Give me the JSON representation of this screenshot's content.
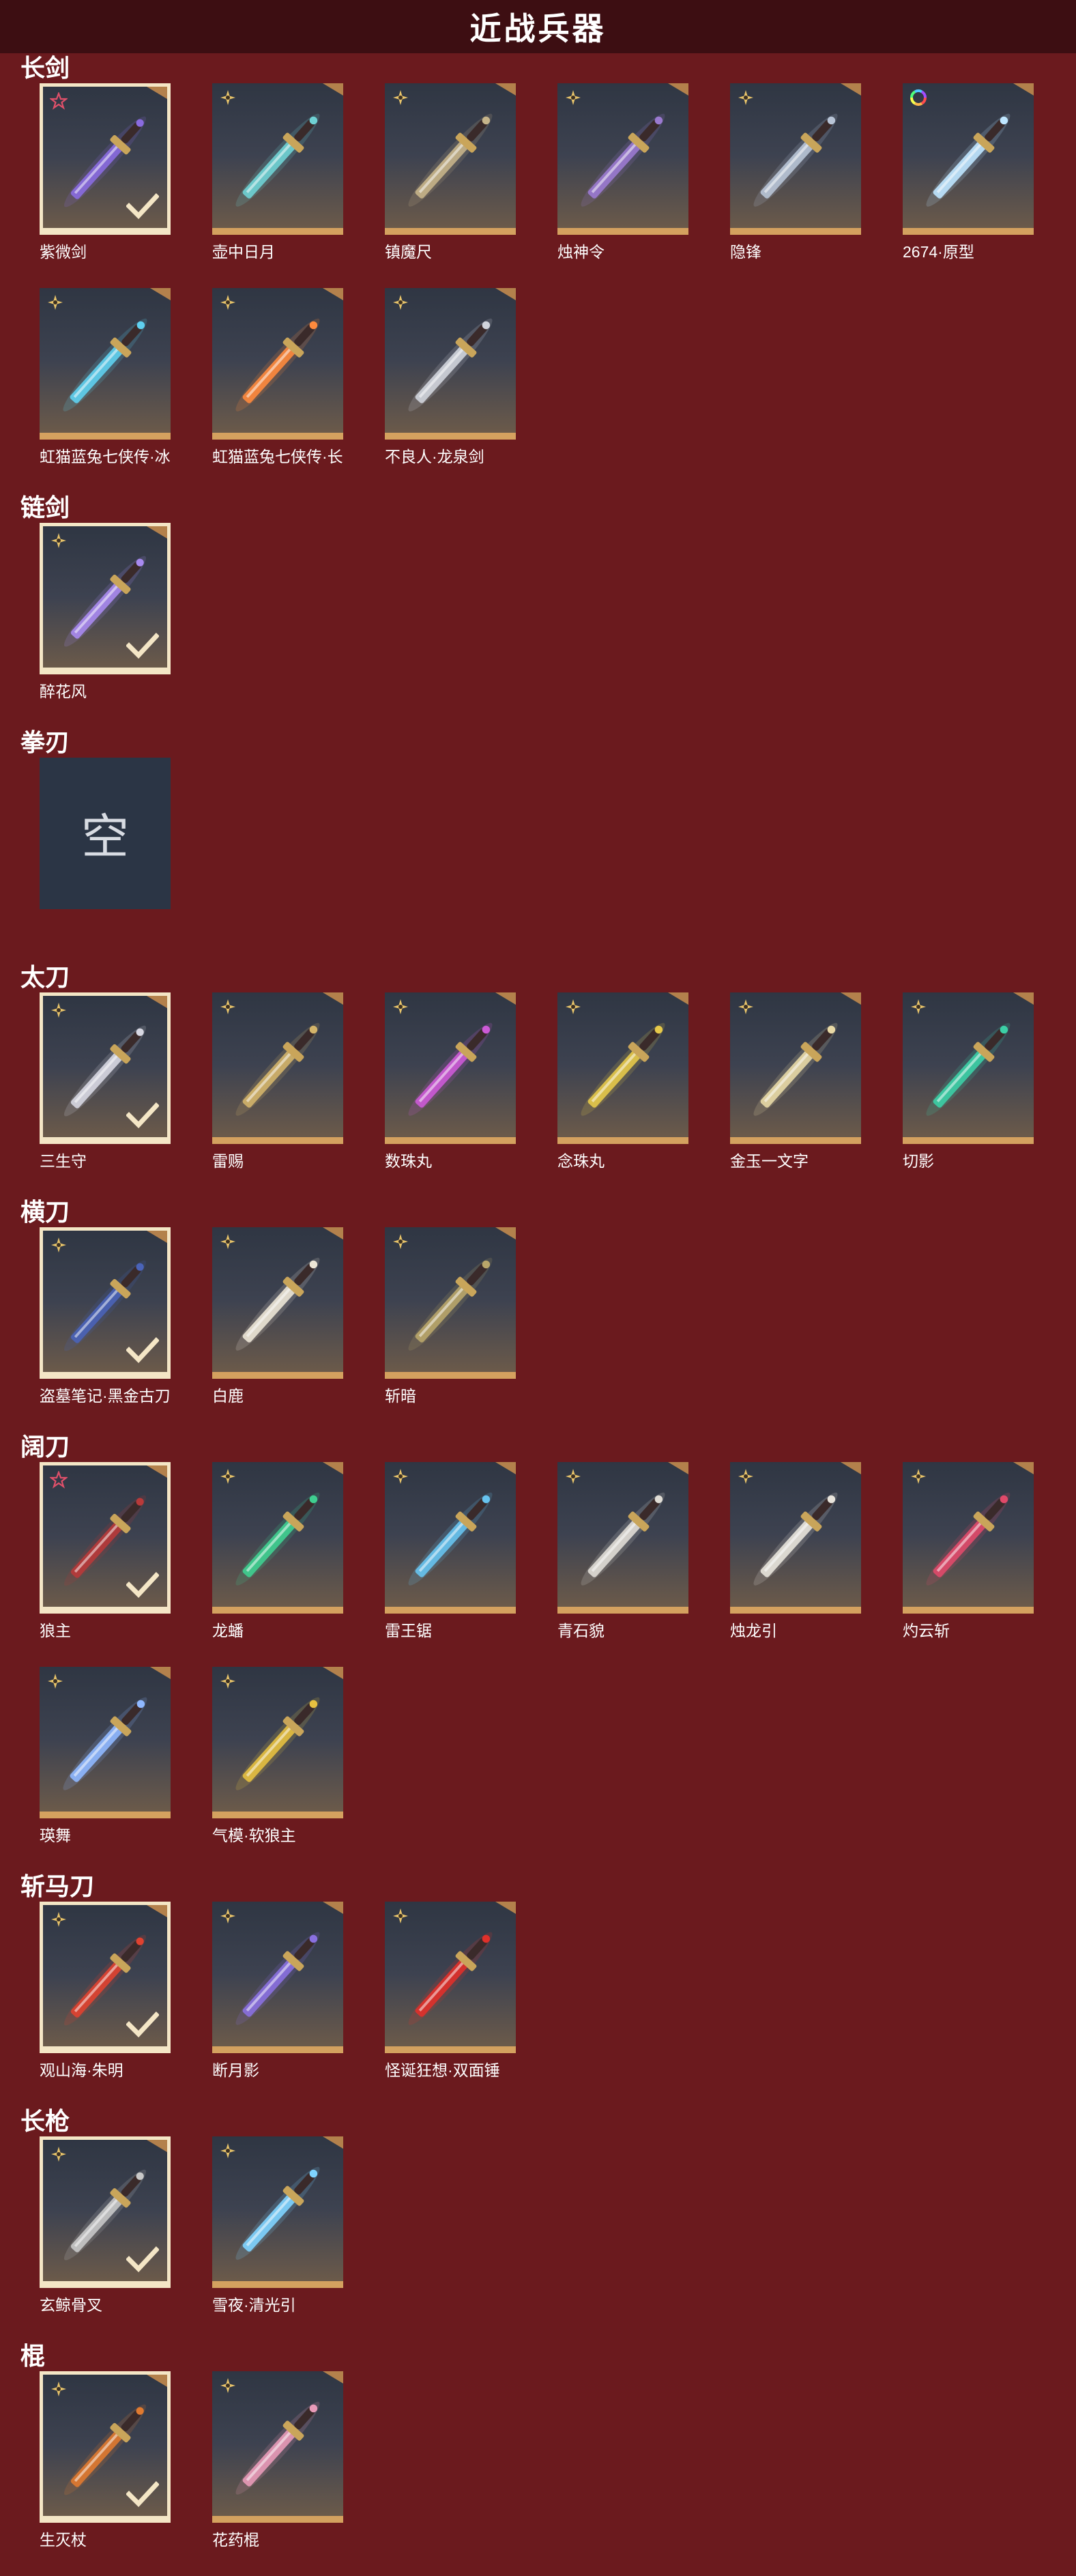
{
  "title": "近战兵器",
  "empty_char": "空",
  "categories": [
    {
      "name": "长剑",
      "rows": [
        [
          {
            "label": "紫微剑",
            "badge": "star",
            "sel": true,
            "c": "#8a6be0"
          },
          {
            "label": "壶中日月",
            "badge": "sparkle",
            "sel": false,
            "c": "#6fd1d4"
          },
          {
            "label": "镇魔尺",
            "badge": "sparkle",
            "sel": false,
            "c": "#c6b48a"
          },
          {
            "label": "烛神令",
            "badge": "sparkle",
            "sel": false,
            "c": "#9b7ad0"
          },
          {
            "label": "隐锋",
            "badge": "sparkle",
            "sel": false,
            "c": "#b8c4d6"
          },
          {
            "label": "2674·原型",
            "badge": "rainbow",
            "sel": false,
            "c": "#bfe6ff"
          }
        ],
        [
          {
            "label": "虹猫蓝兔七侠传·冰魄...",
            "badge": "sparkle",
            "sel": false,
            "c": "#5fd0ef"
          },
          {
            "label": "虹猫蓝兔七侠传·长虹...",
            "badge": "sparkle",
            "sel": false,
            "c": "#ff8a3d"
          },
          {
            "label": "不良人·龙泉剑",
            "badge": "sparkle",
            "sel": false,
            "c": "#d0d4dc"
          }
        ]
      ]
    },
    {
      "name": "链剑",
      "rows": [
        [
          {
            "label": "醉花风",
            "badge": "sparkle",
            "sel": true,
            "c": "#a88af0"
          }
        ]
      ]
    },
    {
      "name": "拳刃",
      "rows": [
        [
          {
            "label": "",
            "badge": "none",
            "sel": false,
            "empty": true
          }
        ]
      ]
    },
    {
      "name": "太刀",
      "rows": [
        [
          {
            "label": "三生守",
            "badge": "sparkle",
            "sel": true,
            "c": "#d7d7e2"
          },
          {
            "label": "雷赐",
            "badge": "sparkle",
            "sel": false,
            "c": "#d3b46a"
          },
          {
            "label": "数珠丸",
            "badge": "sparkle",
            "sel": false,
            "c": "#cc5ad6"
          },
          {
            "label": "念珠丸",
            "badge": "sparkle",
            "sel": false,
            "c": "#e6c94a"
          },
          {
            "label": "金玉一文字",
            "badge": "sparkle",
            "sel": false,
            "c": "#e8d9a6"
          },
          {
            "label": "切影",
            "badge": "sparkle",
            "sel": false,
            "c": "#3ccfa6"
          }
        ]
      ]
    },
    {
      "name": "横刀",
      "rows": [
        [
          {
            "label": "盗墓笔记·黑金古刀",
            "badge": "sparkle",
            "sel": true,
            "c": "#4a63b8"
          },
          {
            "label": "白鹿",
            "badge": "sparkle",
            "sel": false,
            "c": "#ece6d6"
          },
          {
            "label": "斩暗",
            "badge": "sparkle",
            "sel": false,
            "c": "#b9a66a"
          }
        ]
      ]
    },
    {
      "name": "阔刀",
      "rows": [
        [
          {
            "label": "狼主",
            "badge": "star",
            "sel": true,
            "c": "#b83a3a"
          },
          {
            "label": "龙蟠",
            "badge": "sparkle",
            "sel": false,
            "c": "#3fcf90"
          },
          {
            "label": "雷王锯",
            "badge": "sparkle",
            "sel": false,
            "c": "#67c3ef"
          },
          {
            "label": "青石貌",
            "badge": "sparkle",
            "sel": false,
            "c": "#e0ddd6"
          },
          {
            "label": "烛龙引",
            "badge": "sparkle",
            "sel": false,
            "c": "#e8e4dc"
          },
          {
            "label": "灼云斩",
            "badge": "sparkle",
            "sel": false,
            "c": "#e04a6a"
          }
        ],
        [
          {
            "label": "瑛舞",
            "badge": "sparkle",
            "sel": false,
            "c": "#8fb8ff"
          },
          {
            "label": "气模·软狼主",
            "badge": "sparkle",
            "sel": false,
            "c": "#e6c040"
          }
        ]
      ]
    },
    {
      "name": "斩马刀",
      "rows": [
        [
          {
            "label": "观山海·朱明",
            "badge": "sparkle",
            "sel": true,
            "c": "#e04230"
          },
          {
            "label": "断月影",
            "badge": "sparkle",
            "sel": false,
            "c": "#8a70e0"
          },
          {
            "label": "怪诞狂想·双面锤",
            "badge": "sparkle",
            "sel": false,
            "c": "#e0302a"
          }
        ]
      ]
    },
    {
      "name": "长枪",
      "rows": [
        [
          {
            "label": "玄鲸骨叉",
            "badge": "sparkle",
            "sel": true,
            "c": "#c8c8c8"
          },
          {
            "label": "雪夜·清光引",
            "badge": "sparkle",
            "sel": false,
            "c": "#7fd4ff"
          }
        ]
      ]
    },
    {
      "name": "棍",
      "rows": [
        [
          {
            "label": "生灭杖",
            "badge": "sparkle",
            "sel": true,
            "c": "#e07a30"
          },
          {
            "label": "花药棍",
            "badge": "sparkle",
            "sel": false,
            "c": "#e89ab8"
          }
        ]
      ]
    }
  ]
}
